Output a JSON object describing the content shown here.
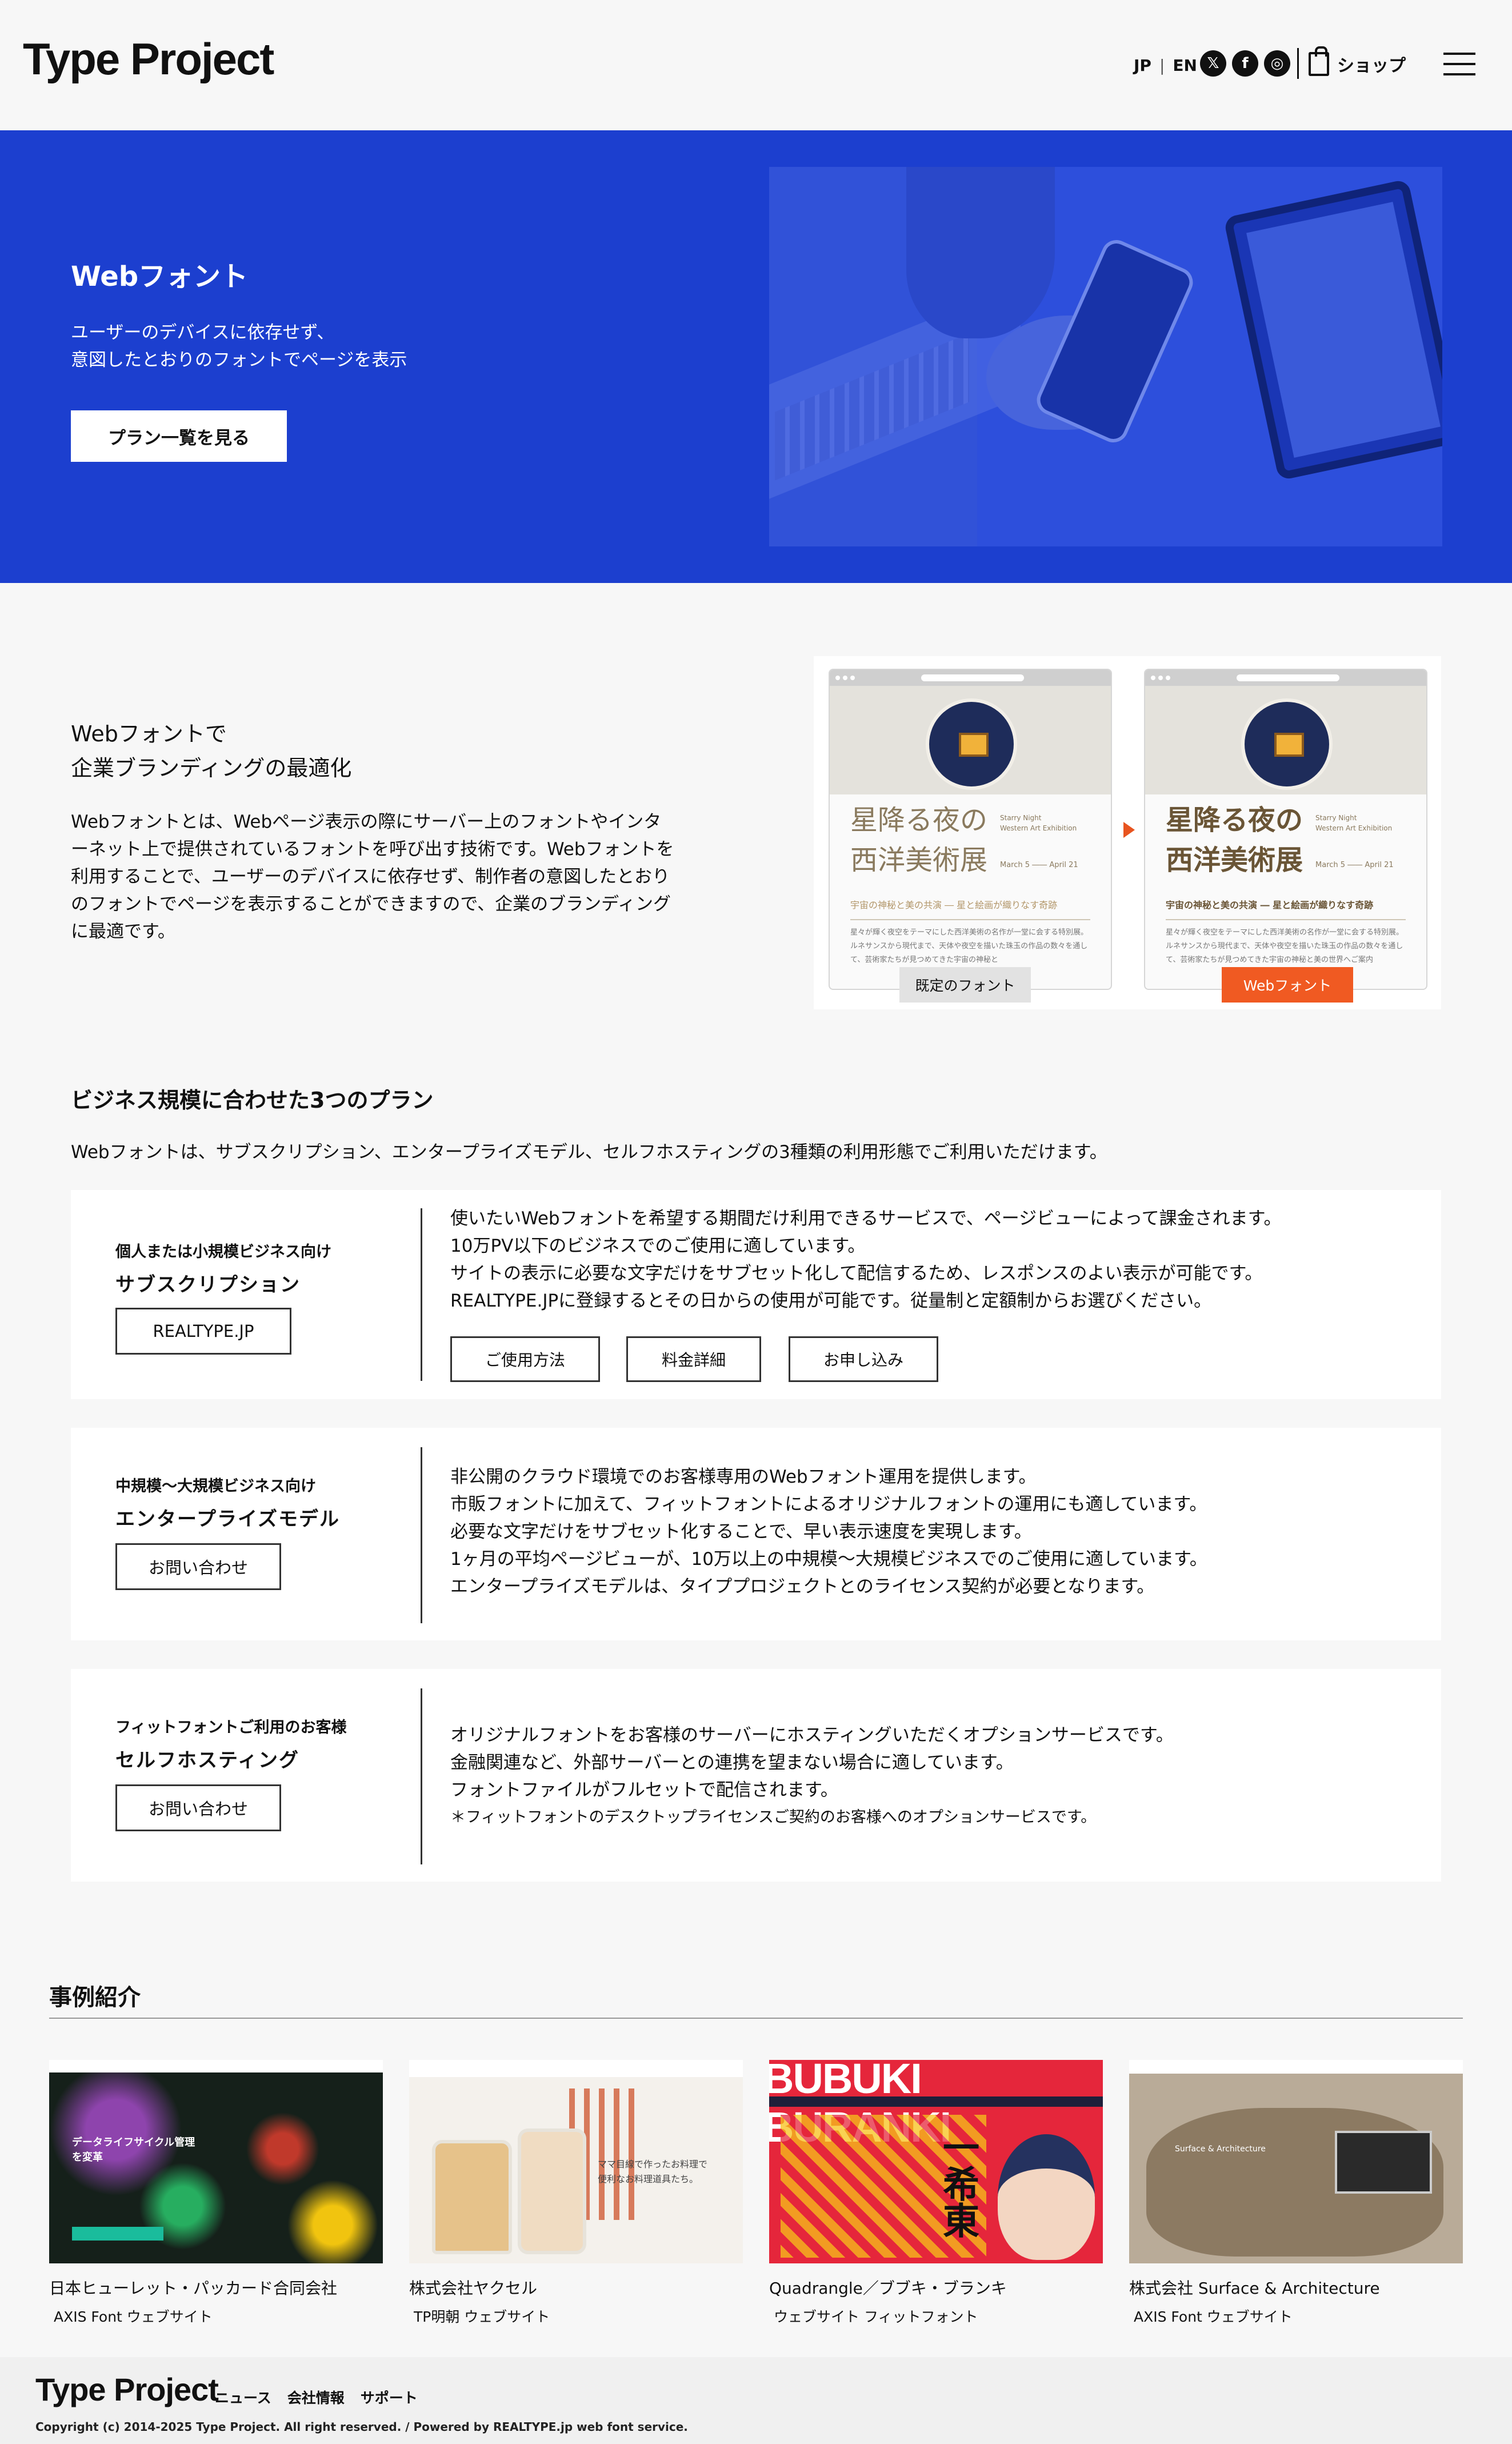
{
  "header": {
    "logo": "Type Project",
    "lang": {
      "jp": "JP",
      "sep": "|",
      "en": "EN"
    },
    "social": [
      {
        "icon": "x-icon",
        "glyph": "𝕏"
      },
      {
        "icon": "facebook-icon",
        "glyph": "f"
      },
      {
        "icon": "instagram-icon",
        "glyph": "◎"
      }
    ],
    "shop_label": "ショップ",
    "menu_icon": "hamburger-menu-icon"
  },
  "hero": {
    "title": "Webフォント",
    "subtitle_line1": "ユーザーのデバイスに依存せず、",
    "subtitle_line2": "意図したとおりのフォントでページを表示",
    "button": "プラン一覧を見る",
    "bg_color": "#1c3fcf"
  },
  "branding": {
    "heading_line1": "Webフォントで",
    "heading_line2": "企業ブランディングの最適化",
    "paragraph_lines": [
      "Webフォントとは、Webページ表示の際にサーバー上のフォントやインタ",
      "ーネット上で提供されているフォントを呼び出す技術です。Webフォントを",
      "利用することで、ユーザーのデバイスに依存せず、制作者の意図したとおり",
      "のフォントでページを表示することができますので、企業のブランディング",
      "に最適です。"
    ],
    "compare": {
      "title_line1": "星降る夜の",
      "title_line2": "西洋美術展",
      "side_line1": "Starry Night",
      "side_line2": "Western Art Exhibition",
      "date_from": "March 5",
      "date_to": "April 21",
      "tagline": "宇宙の神秘と美の共演 ― 星と絵画が織りなす奇跡",
      "body_default": "星々が輝く夜空をテーマにした西洋美術の名作が一堂に会する特別展。ルネサンスから現代まで、天体や夜空を描いた珠玉の作品の数々を通して、芸術家たちが見つめてきた宇宙の神秘と",
      "body_web": "星々が輝く夜空をテーマにした西洋美術の名作が一堂に会する特別展。ルネサンスから現代まで、天体や夜空を描いた珠玉の作品の数々を通して、芸術家たちが見つめてきた宇宙の神秘と美の世界へご案内",
      "caption_default": "既定のフォント",
      "caption_web": "Webフォント",
      "accent": "#f05a22"
    }
  },
  "plans": {
    "heading": "ビジネス規模に合わせた3つのプラン",
    "intro": "Webフォントは、サブスクリプション、エンタープライズモデル、セルフホスティングの3種類の利用形態でご利用いただけます。",
    "items": [
      {
        "tag": "個人または小規模ビジネス向け",
        "name": "サブスクリプション",
        "button": "REALTYPE.JP",
        "desc": [
          "使いたいWebフォントを希望する期間だけ利用できるサービスで、ページビューによって課金されます。",
          "10万PV以下のビジネスでのご使用に適しています。",
          "サイトの表示に必要な文字だけをサブセット化して配信するため、レスポンスのよい表示が可能です。",
          "REALTYPE.JPに登録するとその日からの使用が可能です。従量制と定額制からお選びください。"
        ],
        "sub_buttons": [
          "ご使用方法",
          "料金詳細",
          "お申し込み"
        ]
      },
      {
        "tag": "中規模〜大規模ビジネス向け",
        "name": "エンタープライズモデル",
        "button": "お問い合わせ",
        "desc": [
          "非公開のクラウド環境でのお客様専用のWebフォント運用を提供します。",
          "市販フォントに加えて、フィットフォントによるオリジナルフォントの運用にも適しています。",
          "必要な文字だけをサブセット化することで、早い表示速度を実現します。",
          "1ヶ月の平均ページビューが、10万以上の中規模〜大規模ビジネスでのご使用に適しています。",
          "エンタープライズモデルは、タイププロジェクトとのライセンス契約が必要となります。"
        ]
      },
      {
        "tag": "フィットフォントご利用のお客様",
        "name": "セルフホスティング",
        "button": "お問い合わせ",
        "desc": [
          "オリジナルフォントをお客様のサーバーにホスティングいただくオプションサービスです。",
          "金融関連など、外部サーバーとの連携を望まない場合に適しています。",
          "フォントファイルがフルセットで配信されます。"
        ],
        "note": "＊フィットフォントのデスクトップライセンスご契約のお客様へのオプションサービスです。"
      }
    ]
  },
  "cases": {
    "heading": "事例紹介",
    "items": [
      {
        "company": "日本ヒューレット・パッカード合同会社",
        "detail": "AXIS Font ウェブサイト",
        "overlay_line1": "データライフサイクル管理",
        "overlay_line2": "を変革"
      },
      {
        "company": "株式会社ヤクセル",
        "detail": "TP明朝 ウェブサイト",
        "overlay_line1": "ママ目線で作ったお料理で",
        "overlay_line2": "便利なお料理道具たち。"
      },
      {
        "company": "Quadrangle／ブブキ・ブランキ",
        "detail": "ウェブサイト フィットフォント",
        "overlay_line1": "BUBUKI BURANKI",
        "overlay_line2": "一希東"
      },
      {
        "company": "株式会社 Surface & Architecture",
        "detail": "AXIS Font ウェブサイト",
        "overlay_line1": "Surface & Architecture",
        "overlay_line2": ""
      }
    ]
  },
  "footer": {
    "logo": "Type Project",
    "nav": [
      "ニュース",
      "会社情報",
      "サポート"
    ],
    "copyright": "Copyright (c) 2014-2025 Type Project. All right reserved. / Powered by REALTYPE.jp web font service."
  }
}
